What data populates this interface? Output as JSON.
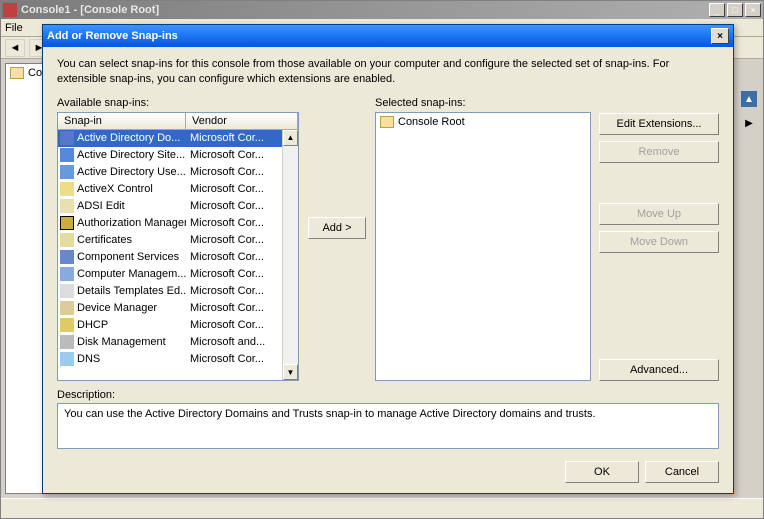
{
  "parent": {
    "title": "Console1 - [Console Root]",
    "menu": {
      "file": "File"
    },
    "tree_root": "Console Root"
  },
  "dialog": {
    "title": "Add or Remove Snap-ins",
    "intro": "You can select snap-ins for this console from those available on your computer and configure the selected set of snap-ins. For extensible snap-ins, you can configure which extensions are enabled.",
    "available_label": "Available snap-ins:",
    "selected_label": "Selected snap-ins:",
    "header_snapin": "Snap-in",
    "header_vendor": "Vendor",
    "add_button": "Add >",
    "buttons": {
      "edit_ext": "Edit Extensions...",
      "remove": "Remove",
      "move_up": "Move Up",
      "move_down": "Move Down",
      "advanced": "Advanced..."
    },
    "selected_root": "Console Root",
    "description_label": "Description:",
    "description_text": "You can use the Active Directory Domains and Trusts snap-in to manage Active Directory domains and trusts.",
    "ok": "OK",
    "cancel": "Cancel",
    "snapins": [
      {
        "name": "Active Directory Do...",
        "vendor": "Microsoft Cor...",
        "icon": "ico-ad",
        "selected": true
      },
      {
        "name": "Active Directory Site...",
        "vendor": "Microsoft Cor...",
        "icon": "ico-adsite"
      },
      {
        "name": "Active Directory Use...",
        "vendor": "Microsoft Cor...",
        "icon": "ico-aduse"
      },
      {
        "name": "ActiveX Control",
        "vendor": "Microsoft Cor...",
        "icon": "ico-activex"
      },
      {
        "name": "ADSI Edit",
        "vendor": "Microsoft Cor...",
        "icon": "ico-adsi"
      },
      {
        "name": "Authorization Manager",
        "vendor": "Microsoft Cor...",
        "icon": "ico-authz"
      },
      {
        "name": "Certificates",
        "vendor": "Microsoft Cor...",
        "icon": "ico-cert"
      },
      {
        "name": "Component Services",
        "vendor": "Microsoft Cor...",
        "icon": "ico-comp"
      },
      {
        "name": "Computer Managem...",
        "vendor": "Microsoft Cor...",
        "icon": "ico-compmgt"
      },
      {
        "name": "Details Templates Ed...",
        "vendor": "Microsoft Cor...",
        "icon": "ico-details"
      },
      {
        "name": "Device Manager",
        "vendor": "Microsoft Cor...",
        "icon": "ico-devmgr"
      },
      {
        "name": "DHCP",
        "vendor": "Microsoft Cor...",
        "icon": "ico-dhcp"
      },
      {
        "name": "Disk Management",
        "vendor": "Microsoft and...",
        "icon": "ico-disk"
      },
      {
        "name": "DNS",
        "vendor": "Microsoft Cor...",
        "icon": "ico-dns"
      }
    ]
  }
}
